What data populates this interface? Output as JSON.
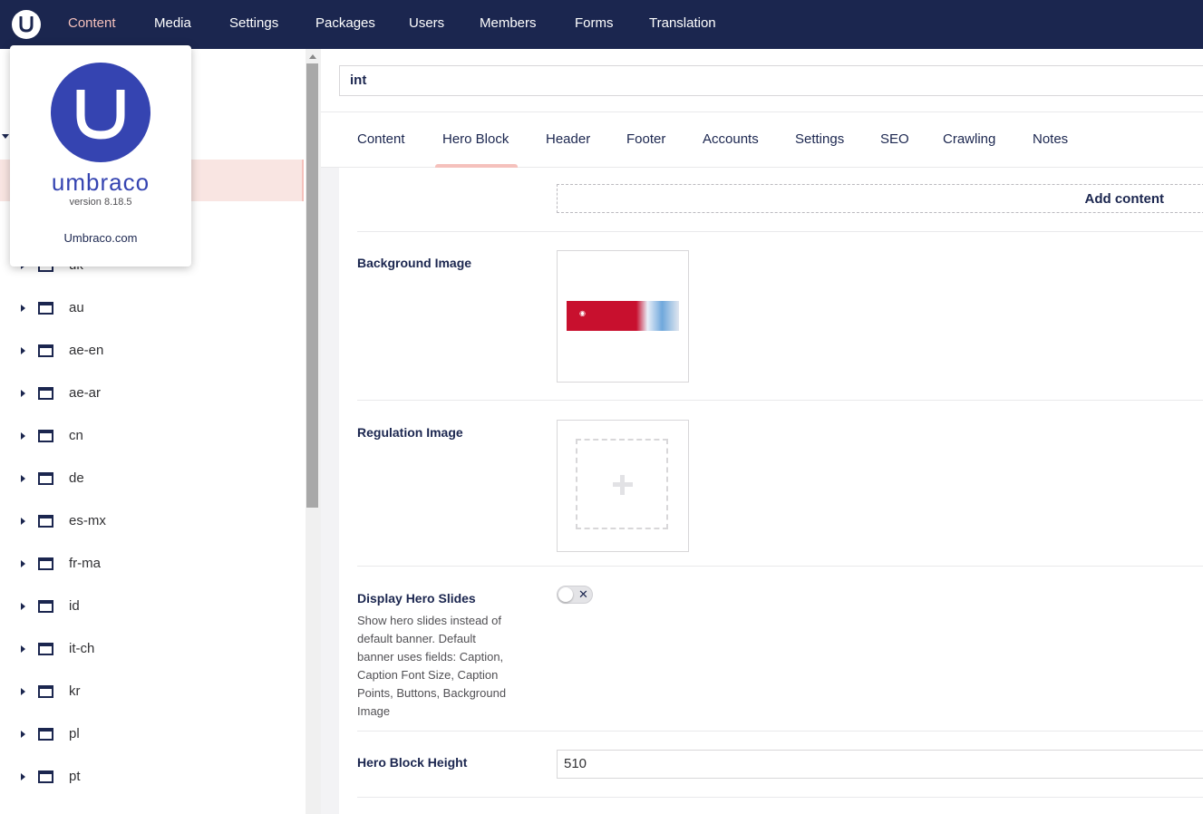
{
  "topnav": {
    "items": [
      {
        "label": "Content",
        "active": true
      },
      {
        "label": "Media",
        "active": false
      },
      {
        "label": "Settings",
        "active": false
      },
      {
        "label": "Packages",
        "active": false
      },
      {
        "label": "Users",
        "active": false
      },
      {
        "label": "Members",
        "active": false
      },
      {
        "label": "Forms",
        "active": false
      },
      {
        "label": "Translation",
        "active": false
      }
    ]
  },
  "about": {
    "brand": "umbraco",
    "version": "version 8.18.5",
    "link": "Umbraco.com"
  },
  "tree": {
    "items": [
      {
        "label": "uk"
      },
      {
        "label": "au"
      },
      {
        "label": "ae-en"
      },
      {
        "label": "ae-ar"
      },
      {
        "label": "cn"
      },
      {
        "label": "de"
      },
      {
        "label": "es-mx"
      },
      {
        "label": "fr-ma"
      },
      {
        "label": "id"
      },
      {
        "label": "it-ch"
      },
      {
        "label": "kr"
      },
      {
        "label": "pl"
      },
      {
        "label": "pt"
      }
    ]
  },
  "editor": {
    "name_value": "int",
    "tabs": [
      {
        "label": "Content"
      },
      {
        "label": "Hero Block",
        "active": true
      },
      {
        "label": "Header"
      },
      {
        "label": "Footer"
      },
      {
        "label": "Accounts"
      },
      {
        "label": "Settings"
      },
      {
        "label": "SEO"
      },
      {
        "label": "Crawling"
      },
      {
        "label": "Notes"
      }
    ],
    "add_content_label": "Add content",
    "properties": {
      "background_image": {
        "label": "Background Image"
      },
      "regulation_image": {
        "label": "Regulation Image"
      },
      "display_hero_slides": {
        "label": "Display Hero Slides",
        "description": "Show hero slides instead of default banner. Default banner uses fields: Caption, Caption Font Size, Caption Points, Buttons, Background Image",
        "value": false
      },
      "hero_block_height": {
        "label": "Hero Block Height",
        "value": "510"
      }
    }
  }
}
